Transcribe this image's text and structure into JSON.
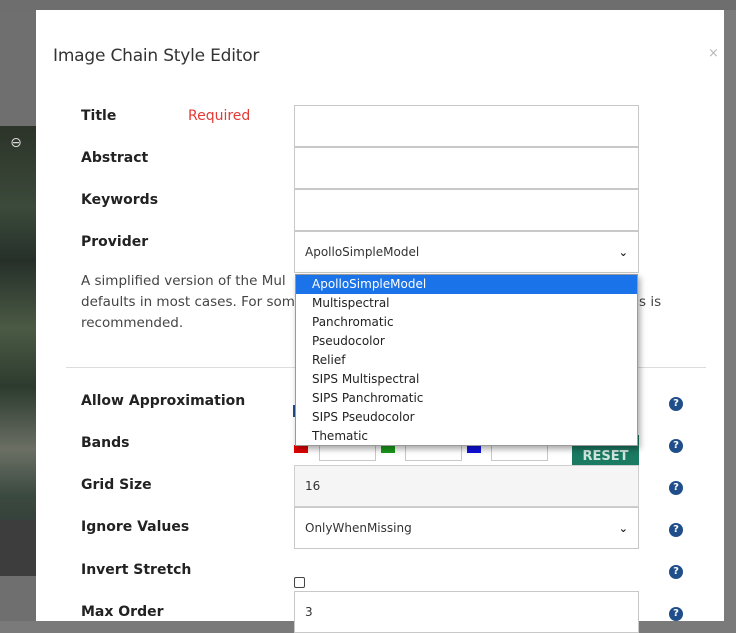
{
  "modal": {
    "title": "Image Chain Style Editor",
    "close_symbol": "×",
    "required_label": "Required",
    "description": {
      "line1": "A simplified version of the Mul",
      "line2": "defaults in most cases. For som",
      "line2_end": "s is",
      "line3": "recommended."
    }
  },
  "fields": {
    "title": {
      "label": "Title",
      "value": ""
    },
    "abstract": {
      "label": "Abstract",
      "value": ""
    },
    "keywords": {
      "label": "Keywords",
      "value": ""
    },
    "provider": {
      "label": "Provider",
      "value": "ApolloSimpleModel",
      "options": [
        "ApolloSimpleModel",
        "Multispectral",
        "Panchromatic",
        "Pseudocolor",
        "Relief",
        "SIPS Multispectral",
        "SIPS Panchromatic",
        "SIPS Pseudocolor",
        "Thematic"
      ]
    },
    "allow_approximation": {
      "label": "Allow Approximation"
    },
    "bands": {
      "label": "Bands",
      "reset_label": "RESET",
      "colors": [
        "#e00000",
        "#1a9a1a",
        "#1010e0"
      ]
    },
    "grid_size": {
      "label": "Grid Size",
      "value": "16"
    },
    "ignore_values": {
      "label": "Ignore Values",
      "value": "OnlyWhenMissing"
    },
    "invert_stretch": {
      "label": "Invert Stretch",
      "checked": false
    },
    "max_order": {
      "label": "Max Order",
      "value": "3"
    }
  },
  "help_symbol": "?",
  "icons": {
    "zoom": "zoom-out-icon",
    "help": "question-circle-icon",
    "close": "close-icon",
    "dropdown": "chevron-down-icon"
  },
  "colors": {
    "required": "#e53935",
    "help": "#1f4e8a",
    "reset": "#1b7a62",
    "selected_option": "#1a73e8"
  }
}
